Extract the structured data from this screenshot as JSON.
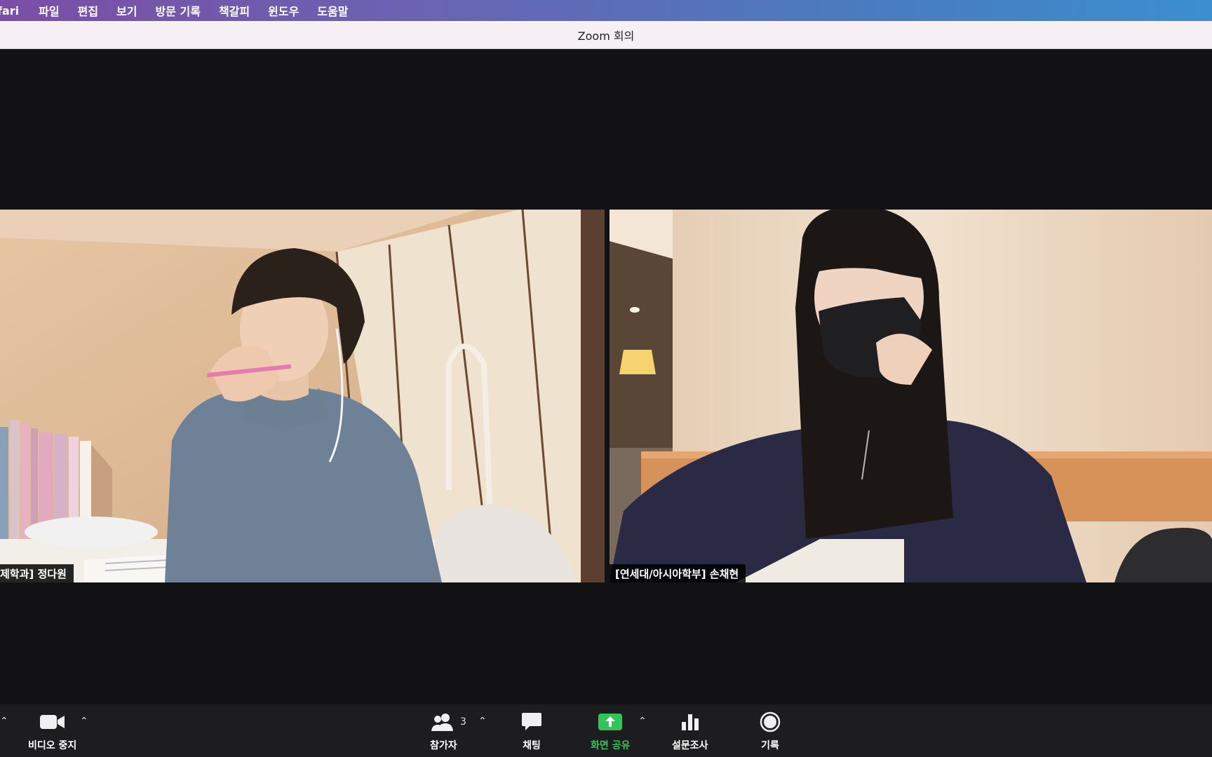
{
  "menubar": {
    "app_name": "fari",
    "items": [
      "파일",
      "편집",
      "보기",
      "방문 기록",
      "책갈피",
      "윈도우",
      "도움말"
    ]
  },
  "window": {
    "title": "Zoom 회의"
  },
  "participants": [
    {
      "name": "제학과] 정다원"
    },
    {
      "name": "[연세대/아시아학부] 손채현"
    }
  ],
  "toolbar": {
    "video_label": "비디오 중지",
    "participants_label": "참가자",
    "participants_count": "3",
    "chat_label": "채팅",
    "share_label": "화면 공유",
    "poll_label": "설문조사",
    "record_label": "기록"
  },
  "colors": {
    "share_green": "#32c45a",
    "toolbar_bg": "#1d1d1f",
    "meeting_bg": "#121214"
  }
}
